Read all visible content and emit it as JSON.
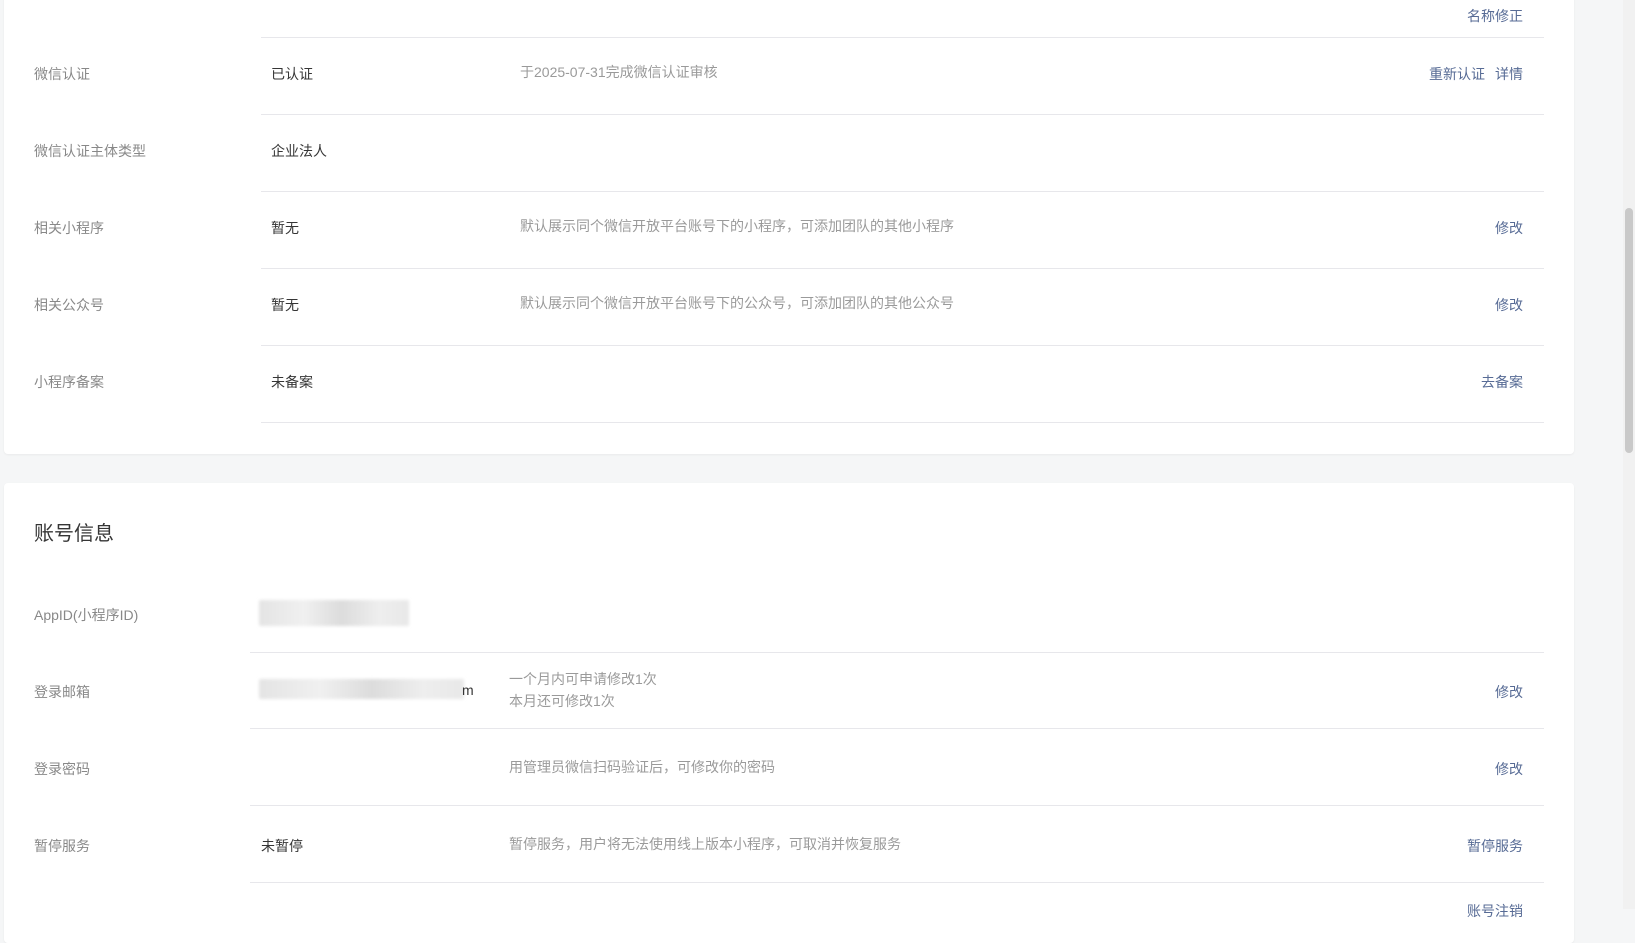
{
  "basic_info": {
    "name_fix_link": "名称修正",
    "rows": [
      {
        "label": "微信认证",
        "value": "已认证",
        "desc": "于2025-07-31完成微信认证审核",
        "actions": [
          "重新认证",
          "详情"
        ]
      },
      {
        "label": "微信认证主体类型",
        "value": "企业法人",
        "desc": "",
        "actions": []
      },
      {
        "label": "相关小程序",
        "value": "暂无",
        "desc": "默认展示同个微信开放平台账号下的小程序，可添加团队的其他小程序",
        "actions": [
          "修改"
        ]
      },
      {
        "label": "相关公众号",
        "value": "暂无",
        "desc": "默认展示同个微信开放平台账号下的公众号，可添加团队的其他公众号",
        "actions": [
          "修改"
        ]
      },
      {
        "label": "小程序备案",
        "value": "未备案",
        "desc": "",
        "actions": [
          "去备案"
        ]
      }
    ]
  },
  "account_info": {
    "title": "账号信息",
    "rows": [
      {
        "label": "AppID(小程序ID)",
        "value": "",
        "desc": "",
        "desc2": "",
        "actions": []
      },
      {
        "label": "登录邮箱",
        "value": "m",
        "desc": "一个月内可申请修改1次",
        "desc2": "本月还可修改1次",
        "actions": [
          "修改"
        ]
      },
      {
        "label": "登录密码",
        "value": "",
        "desc": "用管理员微信扫码验证后，可修改你的密码",
        "desc2": "",
        "actions": [
          "修改"
        ]
      },
      {
        "label": "暂停服务",
        "value": "未暂停",
        "desc": "暂停服务，用户将无法使用线上版本小程序，可取消并恢复服务",
        "desc2": "",
        "actions": [
          "暂停服务"
        ]
      }
    ],
    "partial_bottom_link": "账号注销"
  },
  "colors": {
    "link": "#576b95",
    "label": "#888888",
    "desc": "#9a9a9a",
    "divider": "#e7e7eb"
  }
}
